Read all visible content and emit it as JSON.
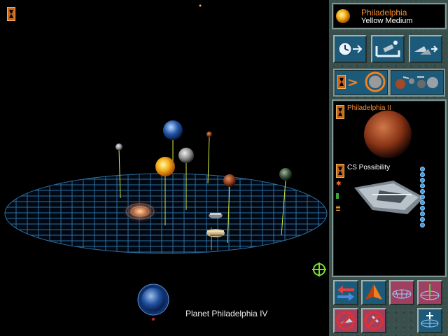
{
  "viewport": {
    "planet_label": "Planet Philadelphia IV"
  },
  "star_header": {
    "name": "Philadelphia",
    "type": "Yellow Medium"
  },
  "planet_info": {
    "name": "Philadelphia II"
  },
  "ship_info": {
    "name": "CS Possibility",
    "stat_pips": 11
  },
  "icons": {
    "toolbar_left": "hourglass-icon",
    "nav_buttons": [
      "clock-forward-icon",
      "orbit-station-icon",
      "ship-fleet-icon"
    ],
    "mode_buttons": [
      "planet-focus-icon",
      "planets-overview-icon"
    ],
    "bottom_buttons": [
      "rotate-arrows-icon",
      "pyramid-icon",
      "grid-flat-icon",
      "grid-axis-icon",
      "no-ship-icon",
      "no-tool-icon",
      "zoom-plus-icon"
    ]
  },
  "colors": {
    "star_name": "#ff8c2a",
    "star_type": "#ffffff",
    "planet_name": "#ff8c2a",
    "grid": "#2d6f9e",
    "stalk": "#d8e83a"
  }
}
